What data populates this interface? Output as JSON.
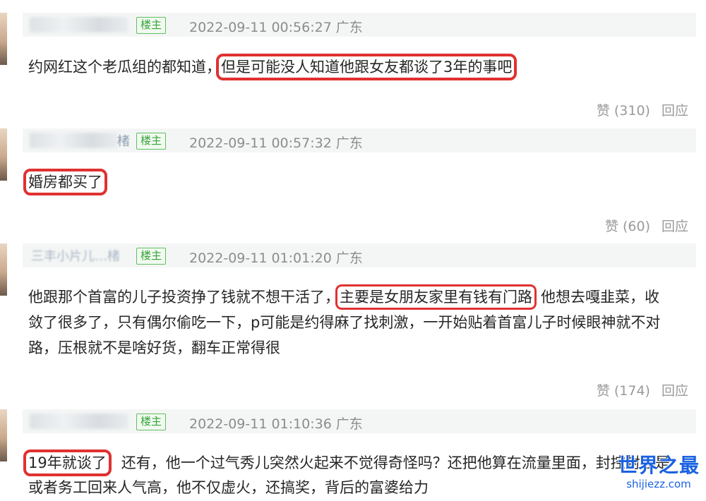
{
  "comments": [
    {
      "username_suffix": "",
      "badge": "楼主",
      "timestamp": "2022-09-11 00:56:27",
      "location": "广东",
      "text_before": "约网红这个老瓜组的都知道，",
      "text_highlight": "但是可能没人知道他跟女友都谈了3年的事吧",
      "text_after": "",
      "likes_label": "赞 (310)",
      "reply_label": "回应"
    },
    {
      "username_suffix": "楮",
      "badge": "楼主",
      "timestamp": "2022-09-11 00:57:32",
      "location": "广东",
      "text_highlight": "婚房都买了",
      "likes_label": "赞 (60)",
      "reply_label": "回应"
    },
    {
      "username_suffix": "三丰小片儿…楮",
      "badge": "楼主",
      "timestamp": "2022-09-11 01:01:20",
      "location": "广东",
      "line1_before": "他跟那个首富的儿子投资挣了钱就不想干活了，",
      "line1_highlight": "主要是女朋友家里有钱有门路",
      "line1_after": "他想去嘎韭菜，收",
      "line2": "敛了很多了，只有偶尔偷吃一下，p可能是约得麻了找刺激，一开始贴着首富儿子时候眼神就不对",
      "line3": "路，压根就不是啥好货，翻车正常得很",
      "likes_label": "赞 (174)",
      "reply_label": "回应"
    },
    {
      "username_suffix": "",
      "badge": "楼主",
      "timestamp": "2022-09-11 01:10:36",
      "location": "广东",
      "line1_highlight": "19年就谈了",
      "line1_after": "，还有，他一个过气秀儿突然火起来不觉得奇怪吗？还把他算在流量里面，封控封控是",
      "line2": "或者务工回来人气高，他不仅虚火，还搞奖，背后的富婆给力"
    }
  ],
  "watermark": {
    "main": "世界之最",
    "sub": "shijiezz.com"
  },
  "colors": {
    "highlight_box": "#e03131",
    "badge_green": "#37a33a",
    "header_bg": "#f4f6f5",
    "watermark_blue": "#1a62e0"
  }
}
